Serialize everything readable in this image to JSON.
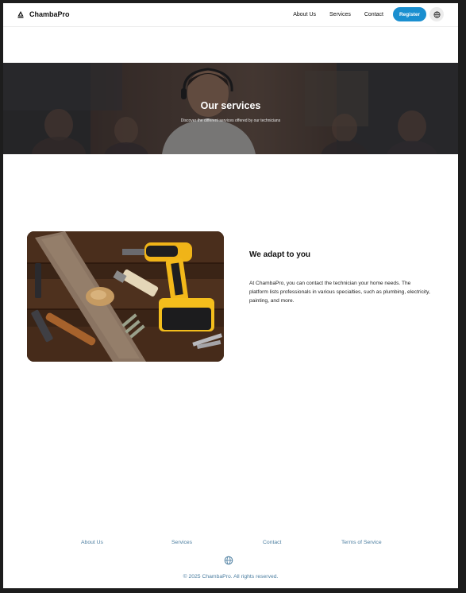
{
  "header": {
    "brand": "ChambaPro",
    "nav": {
      "about": "About Us",
      "services": "Services",
      "contact": "Contact"
    },
    "register_label": "Register",
    "language_icon": "globe-icon"
  },
  "hero": {
    "title": "Our services",
    "subtitle": "Discover the different services offered by our technicians"
  },
  "feature": {
    "image_icon": "tools-photo",
    "heading": "We adapt to you",
    "body": "At ChambaPro, you can contact the technician your home needs. The platform lists professionals in various specialties, such as plumbing, electricity, painting, and more."
  },
  "footer": {
    "links": {
      "about": "About Us",
      "services": "Services",
      "contact": "Contact",
      "terms": "Terms of Service"
    },
    "language_icon": "globe-icon",
    "copyright": "© 2025 ChambaPro. All rights reserved."
  },
  "colors": {
    "accent": "#1a8fd0",
    "footer_text": "#4c7ea0",
    "page_frame": "#1d1d1d"
  }
}
